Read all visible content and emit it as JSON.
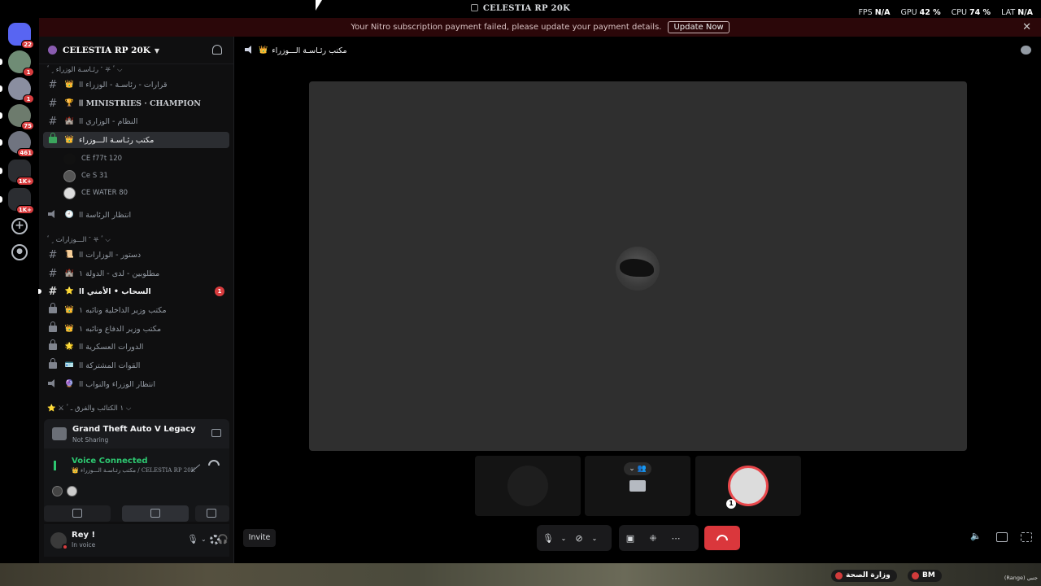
{
  "window": {
    "title": "CELESTIA RP 20K",
    "stats": [
      {
        "label": "FPS",
        "value": "N/A"
      },
      {
        "label": "GPU",
        "value": "42 %"
      },
      {
        "label": "CPU",
        "value": "74 %"
      },
      {
        "label": "LAT",
        "value": "N/A"
      }
    ]
  },
  "notice": {
    "text": "Your Nitro subscription payment failed, please update your payment details.",
    "button": "Update Now"
  },
  "rail": {
    "servers": [
      {
        "badge": "22"
      },
      {
        "badge": "1"
      },
      {
        "badge": "1"
      },
      {
        "badge": "75"
      },
      {
        "badge": "461"
      },
      {
        "badge": "1K+"
      },
      {
        "badge": "1K+"
      }
    ],
    "add_label": "+"
  },
  "sidebar": {
    "server_name": "CELESTIA RP 20K",
    "categories": [
      "ٴ ⛧ ˹ رئـاسـة الوزراء ˼ ٴ ⌵",
      "ٴ ⛧ ˹ الـــوزارات ˼ ٴ ⌵",
      "⭐ ⚔ ١ الكتائب والفرق ـ ٴ ⌵"
    ],
    "channels": [
      {
        "name": "قرارات - رئاسـة - الوزراء اا",
        "emoji": "👑"
      },
      {
        "name": "اا MINISTRIES · CHAMPION",
        "emoji": "🏆"
      },
      {
        "name": "النظام - الوزاري اا",
        "emoji": "🏰"
      },
      {
        "name": "مكتب رئـاسـة الـــوزراء",
        "emoji": "👑"
      },
      {
        "name": "انتظار الرئاسة اا",
        "emoji": "🕘"
      },
      {
        "name": "دستور - الوزارات اا",
        "emoji": "📜"
      },
      {
        "name": "مطلوبين - لدى - الدولة ١",
        "emoji": "🏰"
      },
      {
        "name": "السحاب • الأمني اا",
        "emoji": "⭐",
        "count": "1"
      },
      {
        "name": "مكتب وزير الداخلية ونائبه ١",
        "emoji": "👑"
      },
      {
        "name": "مكتب وزير الدفاع ونائبه ١",
        "emoji": "👑"
      },
      {
        "name": "الدورات العسكرية اا",
        "emoji": "🌟"
      },
      {
        "name": "القوات المشتركة اا",
        "emoji": "🪪"
      },
      {
        "name": "انتظار الوزراء والنواب اا",
        "emoji": "🔮"
      }
    ],
    "voice_users": [
      "CE f77t 120",
      "Ce S 31",
      "CE WATER 80"
    ]
  },
  "activity": {
    "game": "Grand Theft Auto V Legacy",
    "status": "Not Sharing"
  },
  "voice": {
    "title": "Voice Connected",
    "subtitle": "👑 مكتب رئـاسـة الـــوزراء / CELESTIA RP 20K"
  },
  "user": {
    "name": "Rey !",
    "status": "In voice"
  },
  "main": {
    "channel_name": "مكتب رئـاسـة الـــوزراء",
    "channel_emoji": "👑",
    "invite_label": "Invite",
    "tile_number": "1"
  },
  "taskbar": {
    "tags": [
      "وزارة الصحة",
      "BM"
    ],
    "range": "(Range) جنبي"
  },
  "colors": {
    "accent_green": "#2dc770",
    "danger": "#da373c",
    "notice_bg": "#2b0709"
  }
}
